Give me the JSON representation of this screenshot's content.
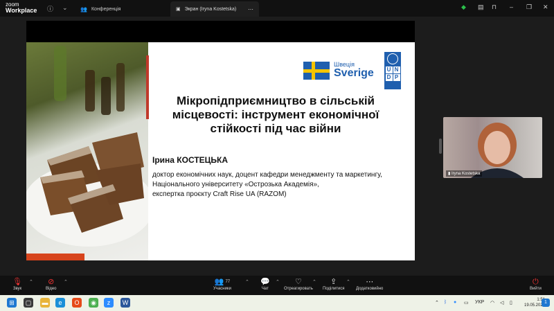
{
  "titlebar": {
    "logo_line1": "zoom",
    "logo_line2": "Workplace",
    "tabs": [
      {
        "label": "Конференція",
        "icon": "people-icon"
      },
      {
        "label": "Экран (Iryna Kostetska)",
        "icon": "screen-share-icon"
      }
    ]
  },
  "slide": {
    "title": "Мікропідприємництво в сільській місцевості: інструмент економічної стійкості під час війни",
    "sweden_small": "Швеція",
    "sweden_big": "Sverige",
    "undp_letters": [
      "U",
      "N",
      "D",
      "P"
    ],
    "speaker_name": "Ірина КОСТЕЦЬКА",
    "speaker_desc": [
      "доктор економічних наук, доцент кафедри менеджменту та маркетингу,",
      "Національного університету «Острозька Академія»,",
      "експертка проєкту Craft Rise UA (RAZOM)"
    ],
    "colors": {
      "accent": "#c0392b",
      "orange": "#d7441c",
      "undp_blue": "#1f5fae",
      "flag_yellow": "#f4c400"
    }
  },
  "video": {
    "participant_name": "Iryna Kostetska"
  },
  "toolbar": {
    "audio": "Звук",
    "video": "Відео",
    "participants": "Учасники",
    "participants_count": "77",
    "chat": "Чат",
    "react": "Отреагировать",
    "share": "Поділитися",
    "more": "Додатковийно",
    "leave": "Вийти"
  },
  "taskbar": {
    "lang": "УКР",
    "time": "1:51",
    "date": "19.05.2026"
  }
}
